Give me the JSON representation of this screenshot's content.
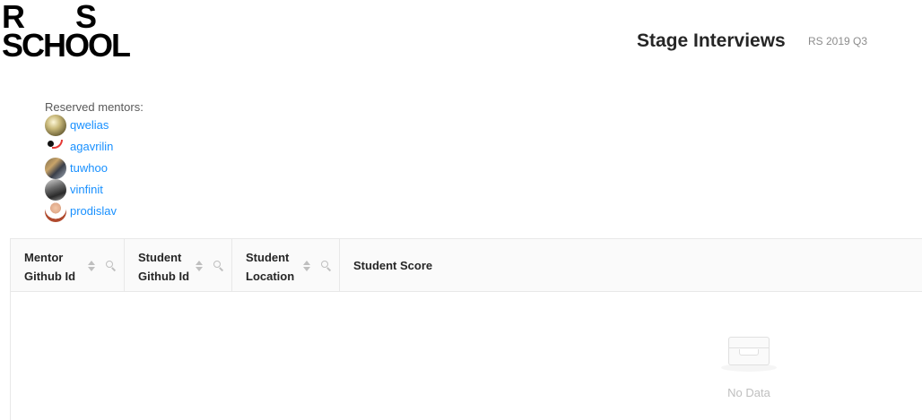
{
  "logo": {
    "line1_left": "R",
    "line1_right": "S",
    "line2": "SCHOOL"
  },
  "header": {
    "title": "Stage Interviews",
    "subtitle": "RS 2019 Q3"
  },
  "mentors": {
    "label": "Reserved mentors:",
    "items": [
      {
        "github": "qwelias"
      },
      {
        "github": "agavrilin"
      },
      {
        "github": "tuwhoo"
      },
      {
        "github": "vinfinit"
      },
      {
        "github": "prodislav"
      }
    ]
  },
  "table": {
    "columns": [
      {
        "label": "Mentor Github Id",
        "sortable": true,
        "filterable": true
      },
      {
        "label": "Student Github Id",
        "sortable": true,
        "filterable": true
      },
      {
        "label": "Student Location",
        "sortable": true,
        "filterable": true
      },
      {
        "label": "Student Score",
        "sortable": false,
        "filterable": false
      }
    ],
    "rows": [],
    "empty_text": "No Data"
  },
  "icons": {
    "sort": "sort-icon",
    "filter": "search-icon",
    "empty": "inbox-icon"
  },
  "colors": {
    "link": "#1890ff",
    "muted": "#8c8c8c",
    "border": "#e8e8e8",
    "header_bg": "#fafafa"
  }
}
